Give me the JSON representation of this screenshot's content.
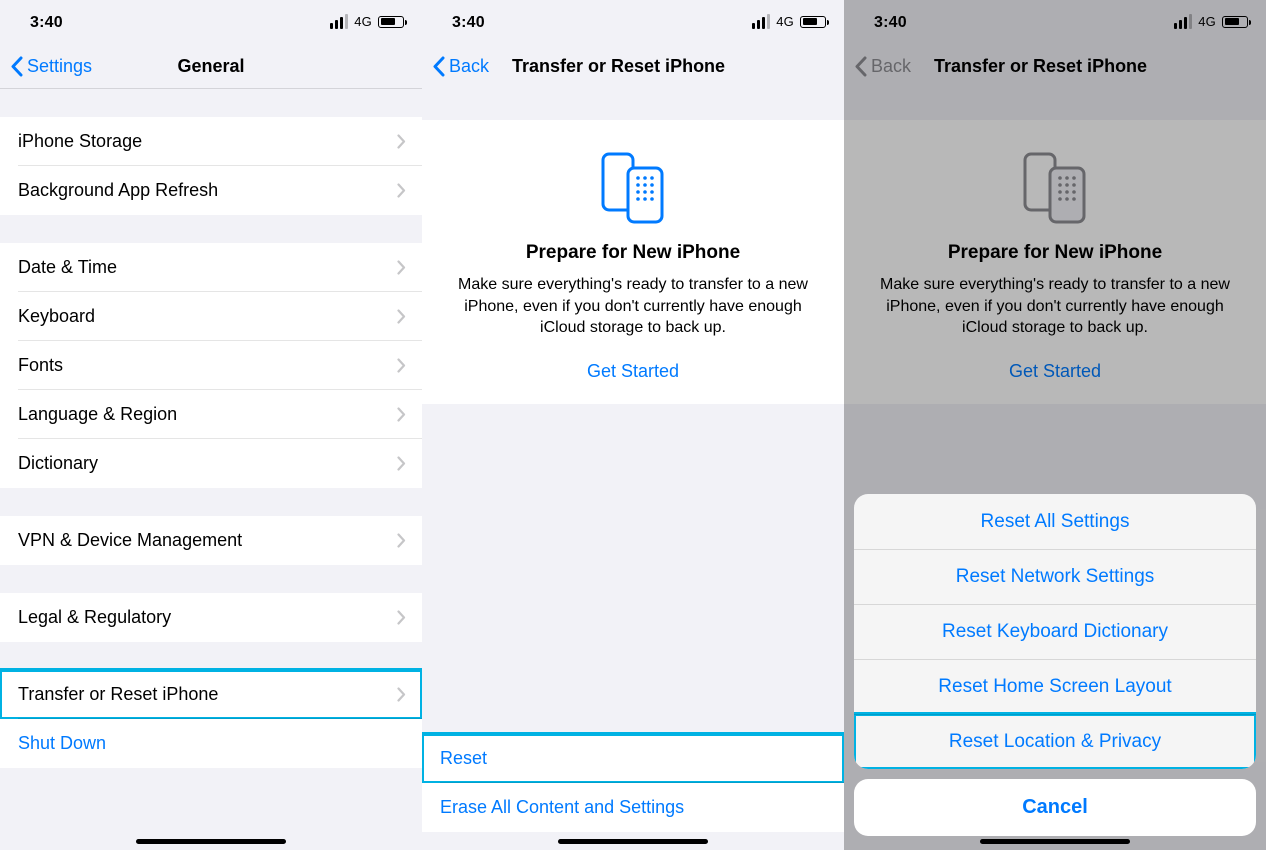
{
  "status": {
    "time": "3:40",
    "network": "4G"
  },
  "screen1": {
    "nav": {
      "back": "Settings",
      "title": "General"
    },
    "rows": {
      "iphone_storage": "iPhone Storage",
      "background_refresh": "Background App Refresh",
      "date_time": "Date & Time",
      "keyboard": "Keyboard",
      "fonts": "Fonts",
      "language_region": "Language & Region",
      "dictionary": "Dictionary",
      "vpn": "VPN & Device Management",
      "legal": "Legal & Regulatory",
      "transfer_reset": "Transfer or Reset iPhone",
      "shut_down": "Shut Down"
    }
  },
  "screen2": {
    "nav": {
      "back": "Back",
      "title": "Transfer or Reset iPhone"
    },
    "hero": {
      "heading": "Prepare for New iPhone",
      "body": "Make sure everything's ready to transfer to a new iPhone, even if you don't currently have enough iCloud storage to back up.",
      "link": "Get Started"
    },
    "actions": {
      "reset": "Reset",
      "erase": "Erase All Content and Settings"
    }
  },
  "screen3": {
    "nav": {
      "back": "Back",
      "title": "Transfer or Reset iPhone"
    },
    "hero": {
      "heading": "Prepare for New iPhone",
      "body": "Make sure everything's ready to transfer to a new iPhone, even if you don't currently have enough iCloud storage to back up.",
      "link": "Get Started"
    },
    "sheet": {
      "items": [
        "Reset All Settings",
        "Reset Network Settings",
        "Reset Keyboard Dictionary",
        "Reset Home Screen Layout",
        "Reset Location & Privacy"
      ],
      "cancel": "Cancel"
    }
  }
}
